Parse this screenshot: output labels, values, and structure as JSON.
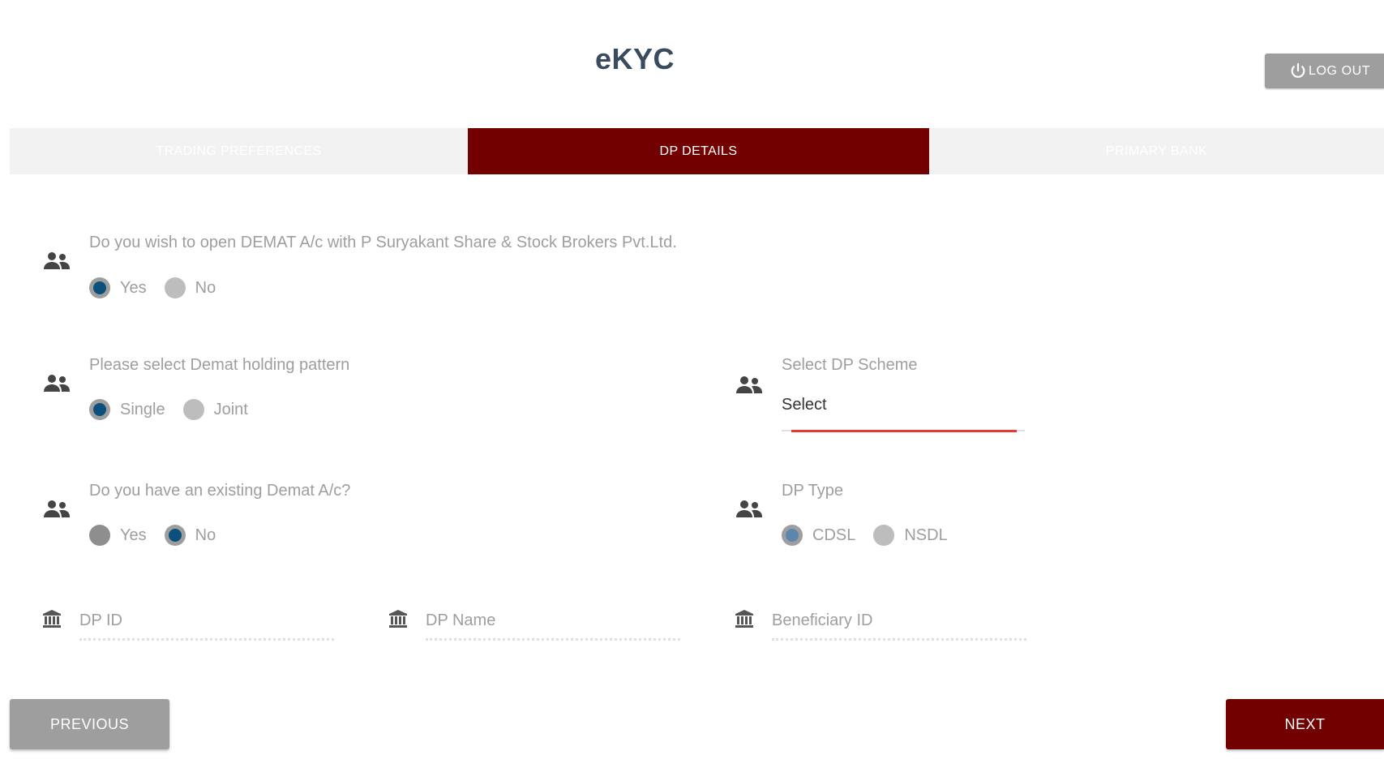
{
  "header": {
    "title": "eKYC",
    "logout_label": "LOG OUT"
  },
  "tabs": [
    {
      "label": "TRADING PREFERENCES",
      "active": false
    },
    {
      "label": "DP DETAILS",
      "active": true
    },
    {
      "label": "PRIMARY BANK",
      "active": false
    }
  ],
  "form": {
    "open_demat": {
      "question": "Do you wish to open DEMAT A/c with P Suryakant Share & Stock Brokers Pvt.Ltd.",
      "options": [
        "Yes",
        "No"
      ],
      "selected": "Yes"
    },
    "holding_pattern": {
      "question": "Please select Demat holding pattern",
      "options": [
        "Single",
        "Joint"
      ],
      "selected": "Single"
    },
    "dp_scheme": {
      "label": "Select DP Scheme",
      "value": "Select"
    },
    "existing_demat": {
      "question": "Do you have an existing Demat A/c?",
      "options": [
        "Yes",
        "No"
      ],
      "selected": "No"
    },
    "dp_type": {
      "label": "DP Type",
      "options": [
        "CDSL",
        "NSDL"
      ],
      "selected": "CDSL"
    },
    "dp_id": {
      "placeholder": "DP ID",
      "value": ""
    },
    "dp_name": {
      "placeholder": "DP Name",
      "value": ""
    },
    "beneficiary_id": {
      "placeholder": "Beneficiary ID",
      "value": ""
    }
  },
  "footer": {
    "previous_label": "PREVIOUS",
    "next_label": "NEXT"
  },
  "icons": {
    "people": "people-icon",
    "bank": "bank-icon",
    "power": "power-icon"
  },
  "colors": {
    "brand": "#720000",
    "title": "#3a4a5f",
    "radio_checked": "#0b4f7c",
    "select_underline": "#e53935",
    "muted_button": "#9e9e9e"
  }
}
